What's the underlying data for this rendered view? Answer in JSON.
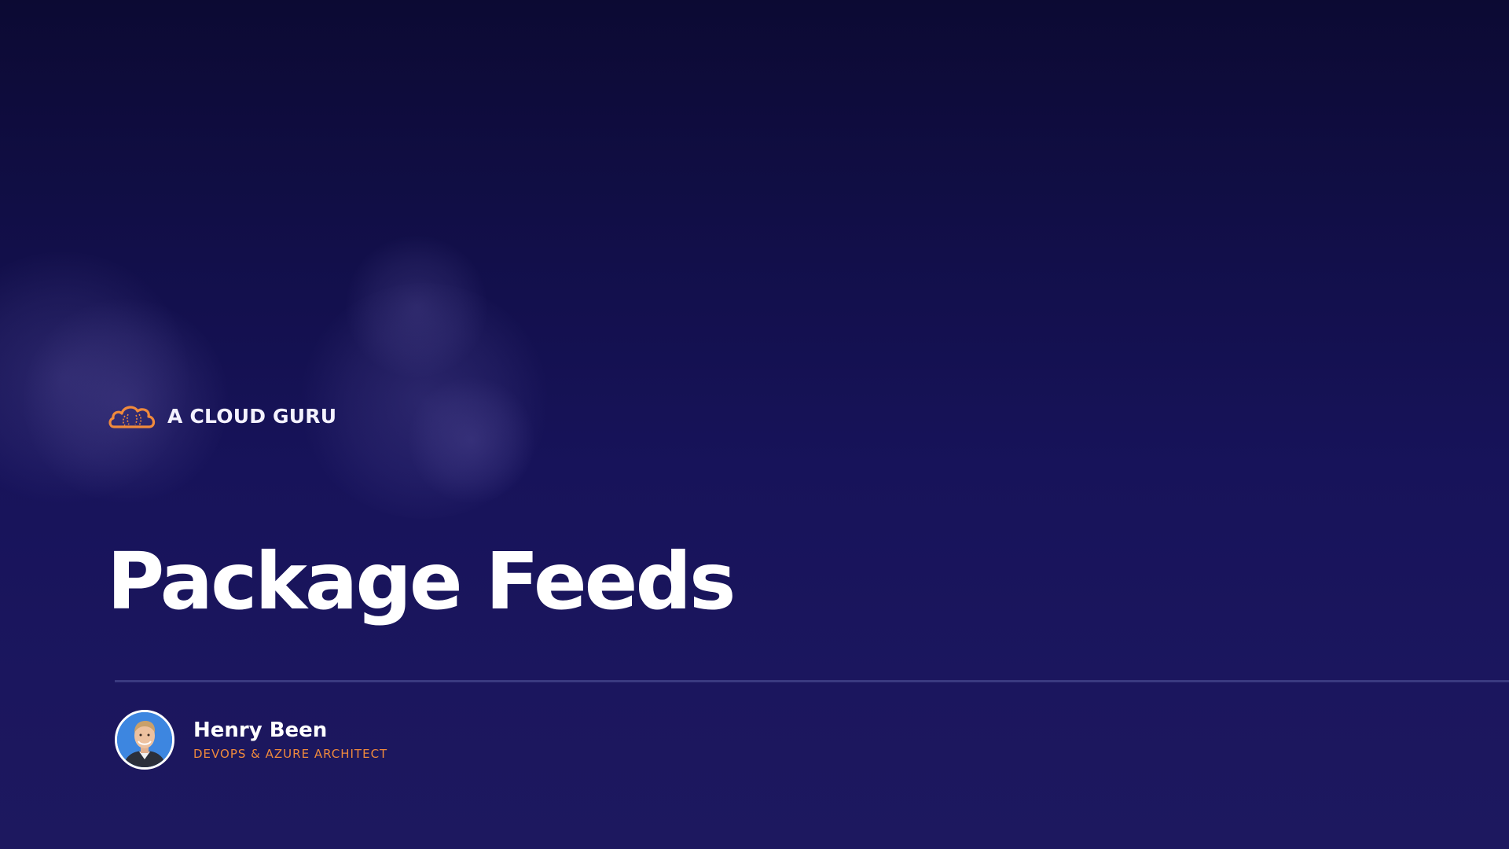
{
  "brand": {
    "name": "A CLOUD GURU",
    "logo_icon": "cloud-logo-icon",
    "accent_color": "#f08a3c"
  },
  "slide": {
    "title": "Package Feeds",
    "background_color": "#17135a"
  },
  "presenter": {
    "name": "Henry Been",
    "role": "DEVOPS & AZURE ARCHITECT",
    "avatar_icon": "avatar-photo-icon"
  }
}
